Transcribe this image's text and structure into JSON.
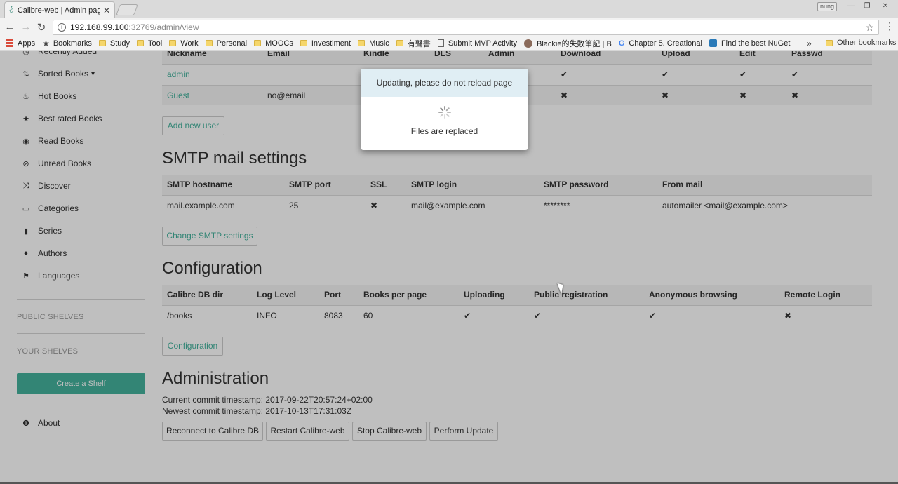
{
  "browser": {
    "tab_title": "Calibre-web | Admin page",
    "tab_close": "✕",
    "user_badge": "nung",
    "url_host": "192.168.99.100",
    "url_path": ":32769/admin/view",
    "bookmarks": [
      {
        "label": "Apps",
        "icon": "apps-grid-icon"
      },
      {
        "label": "Bookmarks",
        "icon": "star-icon"
      },
      {
        "label": "Study",
        "icon": "folder-icon"
      },
      {
        "label": "Tool",
        "icon": "folder-icon"
      },
      {
        "label": "Work",
        "icon": "folder-icon"
      },
      {
        "label": "Personal",
        "icon": "folder-icon"
      },
      {
        "label": "MOOCs",
        "icon": "folder-icon"
      },
      {
        "label": "Investiment",
        "icon": "folder-icon"
      },
      {
        "label": "Music",
        "icon": "folder-icon"
      },
      {
        "label": "有聲書",
        "icon": "folder-icon"
      },
      {
        "label": "Submit MVP Activity",
        "icon": "document-icon"
      },
      {
        "label": "Blackie的失敗筆記 | B",
        "icon": "avatar-icon"
      },
      {
        "label": "Chapter 5. Creational",
        "icon": "google-icon"
      },
      {
        "label": "Find the best NuGet",
        "icon": "nuget-icon"
      }
    ],
    "more_bookmarks": "»",
    "other_bookmarks": "Other bookmarks"
  },
  "sidebar": {
    "items": [
      {
        "label": "Recently Added",
        "icon": "recent-icon"
      },
      {
        "label": "Sorted Books",
        "icon": "sort-icon",
        "caret": "▾"
      },
      {
        "label": "Hot Books",
        "icon": "fire-icon"
      },
      {
        "label": "Best rated Books",
        "icon": "star-icon"
      },
      {
        "label": "Read Books",
        "icon": "eye-icon"
      },
      {
        "label": "Unread Books",
        "icon": "eye-slash-icon"
      },
      {
        "label": "Discover",
        "icon": "random-icon"
      },
      {
        "label": "Categories",
        "icon": "inbox-icon"
      },
      {
        "label": "Series",
        "icon": "bookmark-icon"
      },
      {
        "label": "Authors",
        "icon": "user-icon"
      },
      {
        "label": "Languages",
        "icon": "flag-icon"
      }
    ],
    "public_shelves": "PUBLIC SHELVES",
    "your_shelves": "YOUR SHELVES",
    "create_shelf": "Create a Shelf",
    "about": "About"
  },
  "users_table": {
    "headers": [
      "Nickname",
      "Email",
      "Kindle",
      "DLS",
      "Admin",
      "Download",
      "Upload",
      "Edit",
      "Passwd"
    ],
    "rows": [
      {
        "nickname": "admin",
        "email": "",
        "download": "✔",
        "upload": "✔",
        "edit": "✔",
        "passwd": "✔"
      },
      {
        "nickname": "Guest",
        "email": "no@email",
        "download": "✖",
        "upload": "✖",
        "edit": "✖",
        "passwd": "✖"
      }
    ],
    "add_user": "Add new user"
  },
  "smtp": {
    "title": "SMTP mail settings",
    "headers": [
      "SMTP hostname",
      "SMTP port",
      "SSL",
      "SMTP login",
      "SMTP password",
      "From mail"
    ],
    "row": [
      "mail.example.com",
      "25",
      "✖",
      "mail@example.com",
      "********",
      "automailer <mail@example.com>"
    ],
    "change_button": "Change SMTP settings"
  },
  "configuration": {
    "title": "Configuration",
    "headers": [
      "Calibre DB dir",
      "Log Level",
      "Port",
      "Books per page",
      "Uploading",
      "Public registration",
      "Anonymous browsing",
      "Remote Login"
    ],
    "row": [
      "/books",
      "INFO",
      "8083",
      "60",
      "✔",
      "✔",
      "✔",
      "✖"
    ],
    "button": "Configuration"
  },
  "administration": {
    "title": "Administration",
    "current_commit": "Current commit timestamp: 2017-09-22T20:57:24+02:00",
    "newest_commit": "Newest commit timestamp: 2017-10-13T17:31:03Z",
    "buttons": [
      "Reconnect to Calibre DB",
      "Restart Calibre-web",
      "Stop Calibre-web",
      "Perform Update"
    ]
  },
  "modal": {
    "header": "Updating, please do not reload page",
    "message": "Files are replaced"
  },
  "colors": {
    "accent": "#45b29d",
    "modal_header": "#e0eef4",
    "overlay": "rgba(0,0,0,0.25)"
  }
}
